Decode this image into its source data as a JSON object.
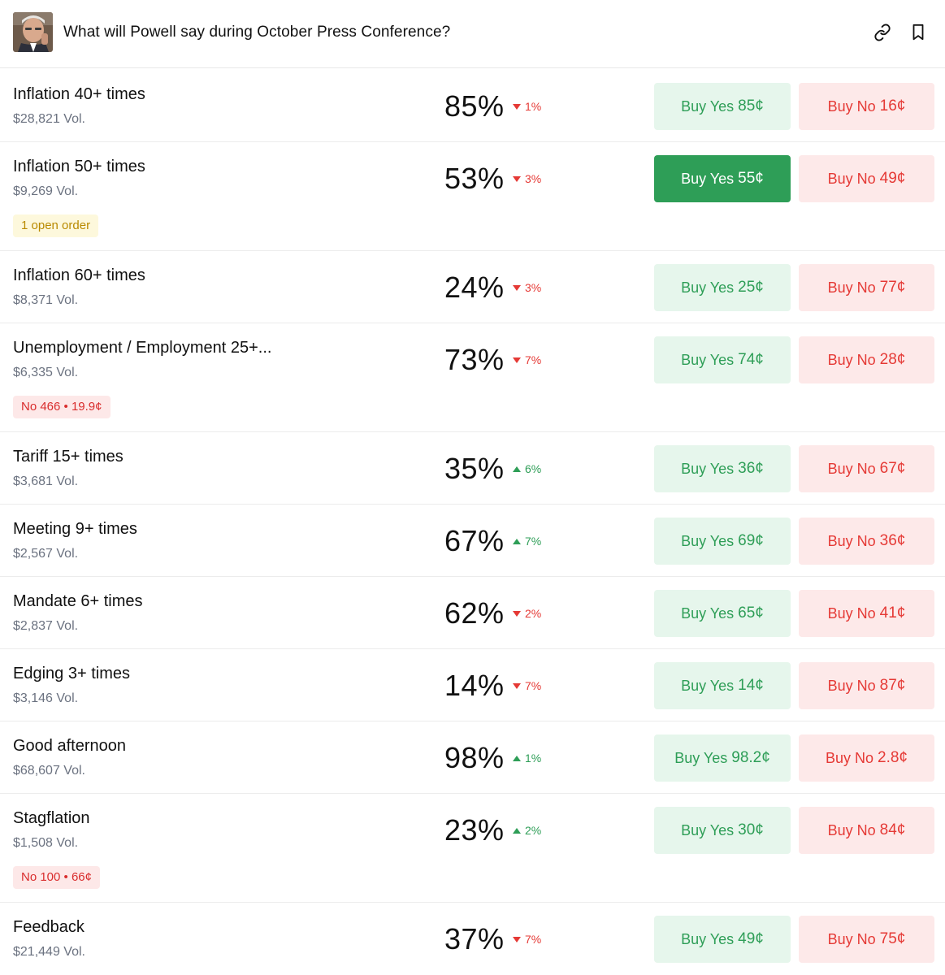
{
  "header": {
    "title": "What will Powell say during October Press Conference?"
  },
  "colors": {
    "green": "#2e9e57",
    "green_bg": "#e6f6ec",
    "red": "#e53935",
    "red_bg": "#fde9e9",
    "order_badge_text": "#b98a00",
    "order_badge_bg": "#fdf8dc"
  },
  "icons": {
    "link": "link-icon",
    "bookmark": "bookmark-icon"
  },
  "markets": [
    {
      "name": "Inflation 40+ times",
      "volume": "$28,821 Vol.",
      "percent": "85%",
      "change": "1%",
      "direction": "down",
      "yes_label": "Buy Yes",
      "yes_price": "85¢",
      "no_label": "Buy No",
      "no_price": "16¢"
    },
    {
      "name": "Inflation 50+ times",
      "volume": "$9,269 Vol.",
      "percent": "53%",
      "change": "3%",
      "direction": "down",
      "yes_label": "Buy Yes",
      "yes_price": "55¢",
      "no_label": "Buy No",
      "no_price": "49¢",
      "yes_active": true,
      "badge": "1 open order",
      "badge_type": "order"
    },
    {
      "name": "Inflation 60+ times",
      "volume": "$8,371 Vol.",
      "percent": "24%",
      "change": "3%",
      "direction": "down",
      "yes_label": "Buy Yes",
      "yes_price": "25¢",
      "no_label": "Buy No",
      "no_price": "77¢"
    },
    {
      "name": "Unemployment / Employment 25+...",
      "volume": "$6,335 Vol.",
      "percent": "73%",
      "change": "7%",
      "direction": "down",
      "yes_label": "Buy Yes",
      "yes_price": "74¢",
      "no_label": "Buy No",
      "no_price": "28¢",
      "badge": "No 466 • 19.9¢",
      "badge_type": "pos"
    },
    {
      "name": "Tariff 15+ times",
      "volume": "$3,681 Vol.",
      "percent": "35%",
      "change": "6%",
      "direction": "up",
      "yes_label": "Buy Yes",
      "yes_price": "36¢",
      "no_label": "Buy No",
      "no_price": "67¢"
    },
    {
      "name": "Meeting 9+ times",
      "volume": "$2,567 Vol.",
      "percent": "67%",
      "change": "7%",
      "direction": "up",
      "yes_label": "Buy Yes",
      "yes_price": "69¢",
      "no_label": "Buy No",
      "no_price": "36¢"
    },
    {
      "name": "Mandate 6+ times",
      "volume": "$2,837 Vol.",
      "percent": "62%",
      "change": "2%",
      "direction": "down",
      "yes_label": "Buy Yes",
      "yes_price": "65¢",
      "no_label": "Buy No",
      "no_price": "41¢"
    },
    {
      "name": "Edging 3+ times",
      "volume": "$3,146 Vol.",
      "percent": "14%",
      "change": "7%",
      "direction": "down",
      "yes_label": "Buy Yes",
      "yes_price": "14¢",
      "no_label": "Buy No",
      "no_price": "87¢"
    },
    {
      "name": "Good afternoon",
      "volume": "$68,607 Vol.",
      "percent": "98%",
      "change": "1%",
      "direction": "up",
      "yes_label": "Buy Yes",
      "yes_price": "98.2¢",
      "no_label": "Buy No",
      "no_price": "2.8¢"
    },
    {
      "name": "Stagflation",
      "volume": "$1,508 Vol.",
      "percent": "23%",
      "change": "2%",
      "direction": "up",
      "yes_label": "Buy Yes",
      "yes_price": "30¢",
      "no_label": "Buy No",
      "no_price": "84¢",
      "badge": "No 100 • 66¢",
      "badge_type": "pos"
    },
    {
      "name": "Feedback",
      "volume": "$21,449 Vol.",
      "percent": "37%",
      "change": "7%",
      "direction": "down",
      "yes_label": "Buy Yes",
      "yes_price": "49¢",
      "no_label": "Buy No",
      "no_price": "75¢"
    }
  ]
}
